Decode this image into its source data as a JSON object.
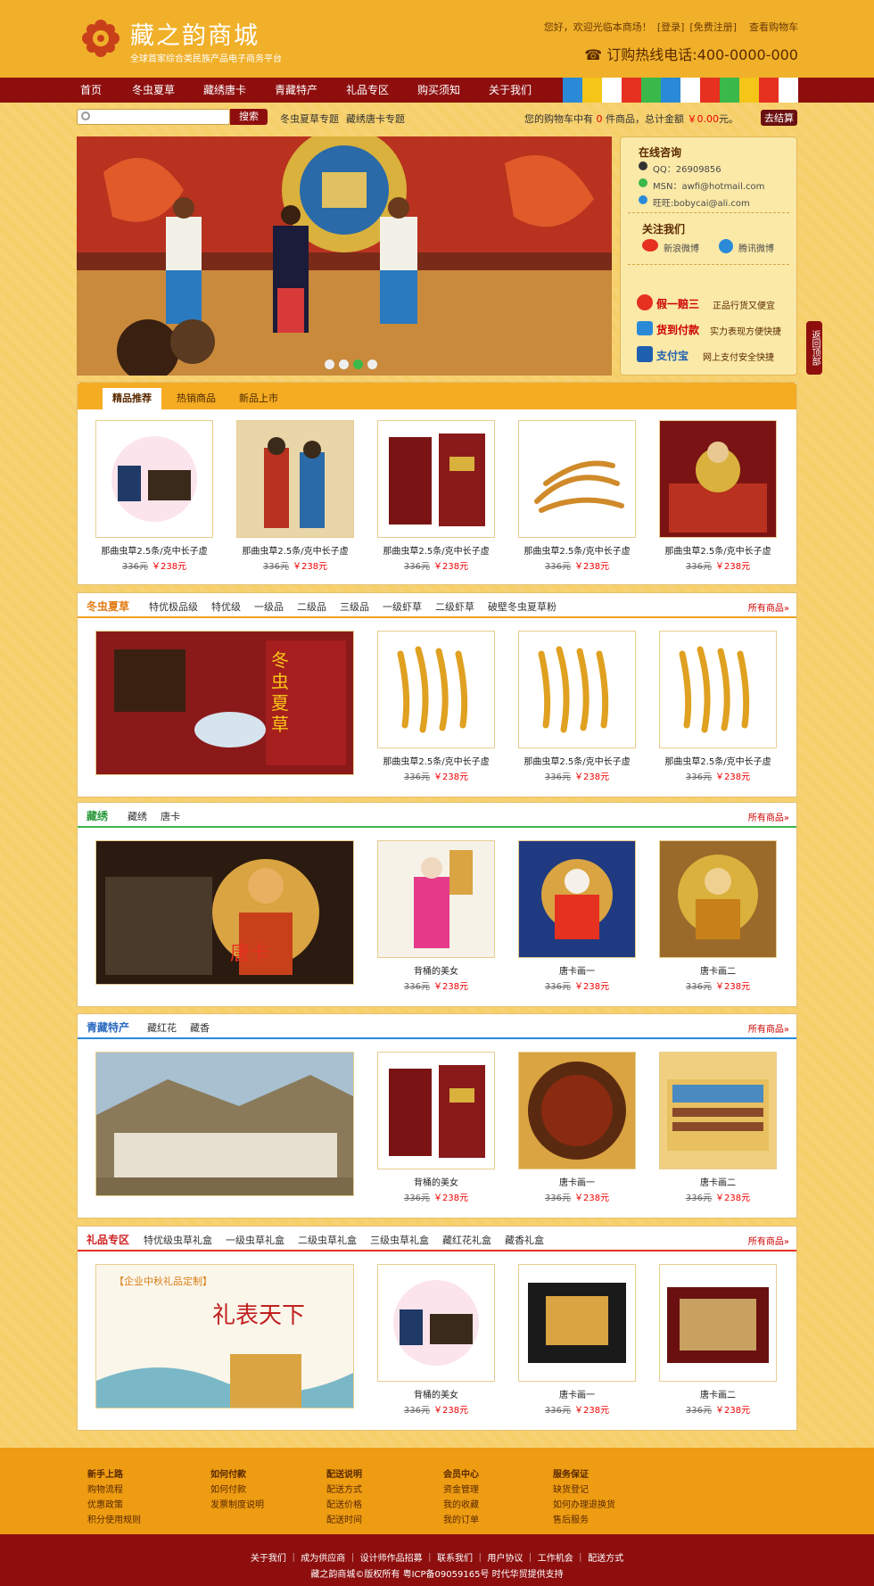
{
  "header": {
    "site_name": "藏之韵商城",
    "slogan": "全球首家综合类民族产品电子商务平台",
    "welcome": "您好，欢迎光临本商场！",
    "login": "[登录]",
    "register": "[免费注册]",
    "view_cart": "查看购物车",
    "hotline": "☎ 订购热线电话:400-0000-000"
  },
  "nav": [
    "首页",
    "冬虫夏草",
    "藏绣唐卡",
    "青藏特产",
    "礼品专区",
    "购买须知",
    "关于我们"
  ],
  "flag_colors": [
    "#2b8ad8",
    "#f5c518",
    "#ffffff",
    "#e63020",
    "#3bb84a",
    "#2b8ad8",
    "#ffffff",
    "#e63020",
    "#3bb84a",
    "#f5c518",
    "#e63020",
    "#ffffff"
  ],
  "search": {
    "button": "搜索",
    "link1": "冬虫夏草专题",
    "link2": "藏绣唐卡专题",
    "cart_pre": "您的购物车中有",
    "cart_count": "0",
    "cart_mid": "件商品，总计金额",
    "cart_amount": "￥0.00",
    "cart_suf": "元。",
    "checkout": "去结算"
  },
  "side": {
    "consult_title": "在线咨询",
    "qq": "QQ：26909856",
    "msn": "MSN：awfi@hotmail.com",
    "ww": "旺旺:bobycai@ali.com",
    "follow_title": "关注我们",
    "weibo": "新浪微博",
    "tweibo": "腾讯微博",
    "g1_title": "假一赔三",
    "g1_text": "正品行货又便宜",
    "g2_title": "货到付款",
    "g2_text": "实力表现方便快捷",
    "g3_title": "支付宝",
    "g3_text": "网上支付安全快捷"
  },
  "backtop": "返回顶部",
  "tabs": {
    "items": [
      "精品推荐",
      "热销商品",
      "新品上市"
    ],
    "products": [
      {
        "name": "那曲虫草2.5条/克中长子虚",
        "old": "336元",
        "new": "￥238元"
      },
      {
        "name": "那曲虫草2.5条/克中长子虚",
        "old": "336元",
        "new": "￥238元"
      },
      {
        "name": "那曲虫草2.5条/克中长子虚",
        "old": "336元",
        "new": "￥238元"
      },
      {
        "name": "那曲虫草2.5条/克中长子虚",
        "old": "336元",
        "new": "￥238元"
      },
      {
        "name": "那曲虫草2.5条/克中长子虚",
        "old": "336元",
        "new": "￥238元"
      }
    ]
  },
  "sec1": {
    "title": "冬虫夏草",
    "subs": [
      "特优极品级",
      "特优级",
      "一级品",
      "二级品",
      "三级品",
      "一级虾草",
      "二级虾草",
      "破壁冬虫夏草粉"
    ],
    "more": "所有商品»",
    "banner_text": "冬虫夏草",
    "products": [
      {
        "name": "那曲虫草2.5条/克中长子虚",
        "old": "336元",
        "new": "￥238元"
      },
      {
        "name": "那曲虫草2.5条/克中长子虚",
        "old": "336元",
        "new": "￥238元"
      },
      {
        "name": "那曲虫草2.5条/克中长子虚",
        "old": "336元",
        "new": "￥238元"
      }
    ]
  },
  "sec2": {
    "title": "藏绣",
    "subs": [
      "藏绣",
      "唐卡"
    ],
    "more": "所有商品»",
    "banner_text": "唐卡",
    "products": [
      {
        "name": "背桶的美女",
        "old": "336元",
        "new": "￥238元"
      },
      {
        "name": "唐卡画一",
        "old": "336元",
        "new": "￥238元"
      },
      {
        "name": "唐卡画二",
        "old": "336元",
        "new": "￥238元"
      }
    ]
  },
  "sec3": {
    "title": "青藏特产",
    "subs": [
      "藏红花",
      "藏香"
    ],
    "more": "所有商品»",
    "products": [
      {
        "name": "背桶的美女",
        "old": "336元",
        "new": "￥238元"
      },
      {
        "name": "唐卡画一",
        "old": "336元",
        "new": "￥238元"
      },
      {
        "name": "唐卡画二",
        "old": "336元",
        "new": "￥238元"
      }
    ]
  },
  "sec4": {
    "title": "礼品专区",
    "subs": [
      "特优级虫草礼盒",
      "一级虫草礼盒",
      "二级虫草礼盒",
      "三级虫草礼盒",
      "藏红花礼盒",
      "藏香礼盒"
    ],
    "more": "所有商品»",
    "banner_tag": "【企业中秋礼品定制】",
    "banner_text": "礼表天下",
    "products": [
      {
        "name": "背桶的美女",
        "old": "336元",
        "new": "￥238元"
      },
      {
        "name": "唐卡画一",
        "old": "336元",
        "new": "￥238元"
      },
      {
        "name": "唐卡画二",
        "old": "336元",
        "new": "￥238元"
      }
    ]
  },
  "footer": {
    "cols": [
      {
        "title": "新手上路",
        "links": [
          "购物流程",
          "优惠政策",
          "积分使用规则"
        ]
      },
      {
        "title": "如何付款",
        "links": [
          "如何付款",
          "发票制度说明"
        ]
      },
      {
        "title": "配送说明",
        "links": [
          "配送方式",
          "配送价格",
          "配送时间"
        ]
      },
      {
        "title": "会员中心",
        "links": [
          "资金管理",
          "我的收藏",
          "我的订单"
        ]
      },
      {
        "title": "服务保证",
        "links": [
          "缺货登记",
          "如何办理退换货",
          "售后服务"
        ]
      }
    ],
    "links": "关于我们 ｜ 成为供应商 ｜ 设计师作品招募 ｜ 联系我们 ｜ 用户协议 ｜ 工作机会 ｜ 配送方式",
    "copyright": "藏之韵商城©版权所有   粤ICP备09059165号   时代华贸提供支持"
  }
}
